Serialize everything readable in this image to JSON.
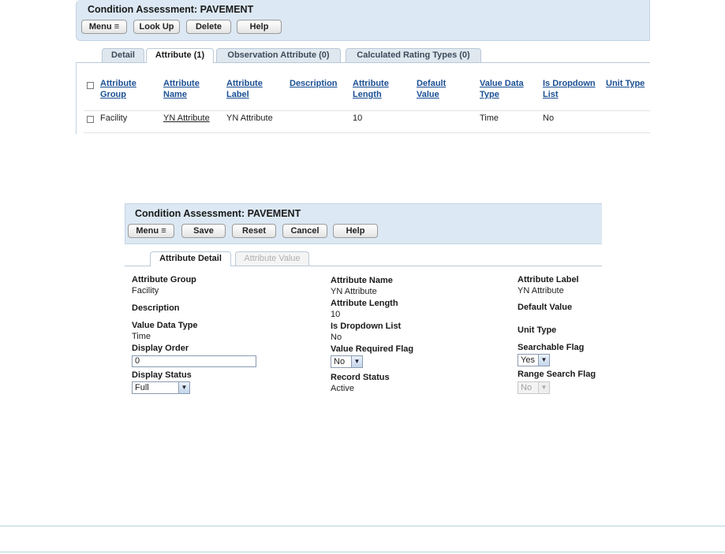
{
  "top": {
    "title": "Condition Assessment: PAVEMENT",
    "buttons": {
      "menu": "Menu",
      "lookup": "Look Up",
      "delete": "Delete",
      "help": "Help"
    },
    "tabs": [
      "Detail",
      "Attribute (1)",
      "Observation Attribute (0)",
      "Calculated Rating Types (0)"
    ],
    "columns": {
      "group": [
        "Attribute",
        "Group"
      ],
      "name": [
        "Attribute",
        "Name"
      ],
      "label": [
        "Attribute",
        "Label"
      ],
      "description": [
        "Description"
      ],
      "length": [
        "Attribute",
        "Length"
      ],
      "default": [
        "Default",
        "Value"
      ],
      "datatype": [
        "Value Data",
        "Type"
      ],
      "dropdown": [
        "Is Dropdown",
        "List"
      ],
      "unit": [
        "Unit Type"
      ]
    },
    "row": {
      "group": "Facility",
      "name": "YN Attribute",
      "label": "YN Attribute",
      "description": "",
      "length": "10",
      "default": "",
      "datatype": "Time",
      "dropdown": "No",
      "unit": ""
    }
  },
  "detail": {
    "title": "Condition Assessment: PAVEMENT",
    "buttons": {
      "menu": "Menu",
      "save": "Save",
      "reset": "Reset",
      "cancel": "Cancel",
      "help": "Help"
    },
    "tabs": [
      "Attribute Detail",
      "Attribute Value"
    ],
    "fields": {
      "attr_group_label": "Attribute Group",
      "attr_group_value": "Facility",
      "attr_name_label": "Attribute Name",
      "attr_name_value": "YN Attribute",
      "attr_label_label": "Attribute Label",
      "attr_label_value": "YN Attribute",
      "description_label": "Description",
      "attr_length_label": "Attribute Length",
      "attr_length_value": "10",
      "default_value_label": "Default Value",
      "value_data_type_label": "Value Data Type",
      "value_data_type_value": "Time",
      "is_dropdown_label": "Is Dropdown List",
      "is_dropdown_value": "No",
      "unit_type_label": "Unit Type",
      "display_order_label": "Display Order",
      "display_order_value": "0",
      "value_required_label": "Value Required Flag",
      "value_required_value": "No",
      "searchable_label": "Searchable Flag",
      "searchable_value": "Yes",
      "display_status_label": "Display Status",
      "display_status_value": "Full",
      "record_status_label": "Record Status",
      "record_status_value": "Active",
      "range_search_label": "Range Search Flag",
      "range_search_value": "No"
    }
  }
}
